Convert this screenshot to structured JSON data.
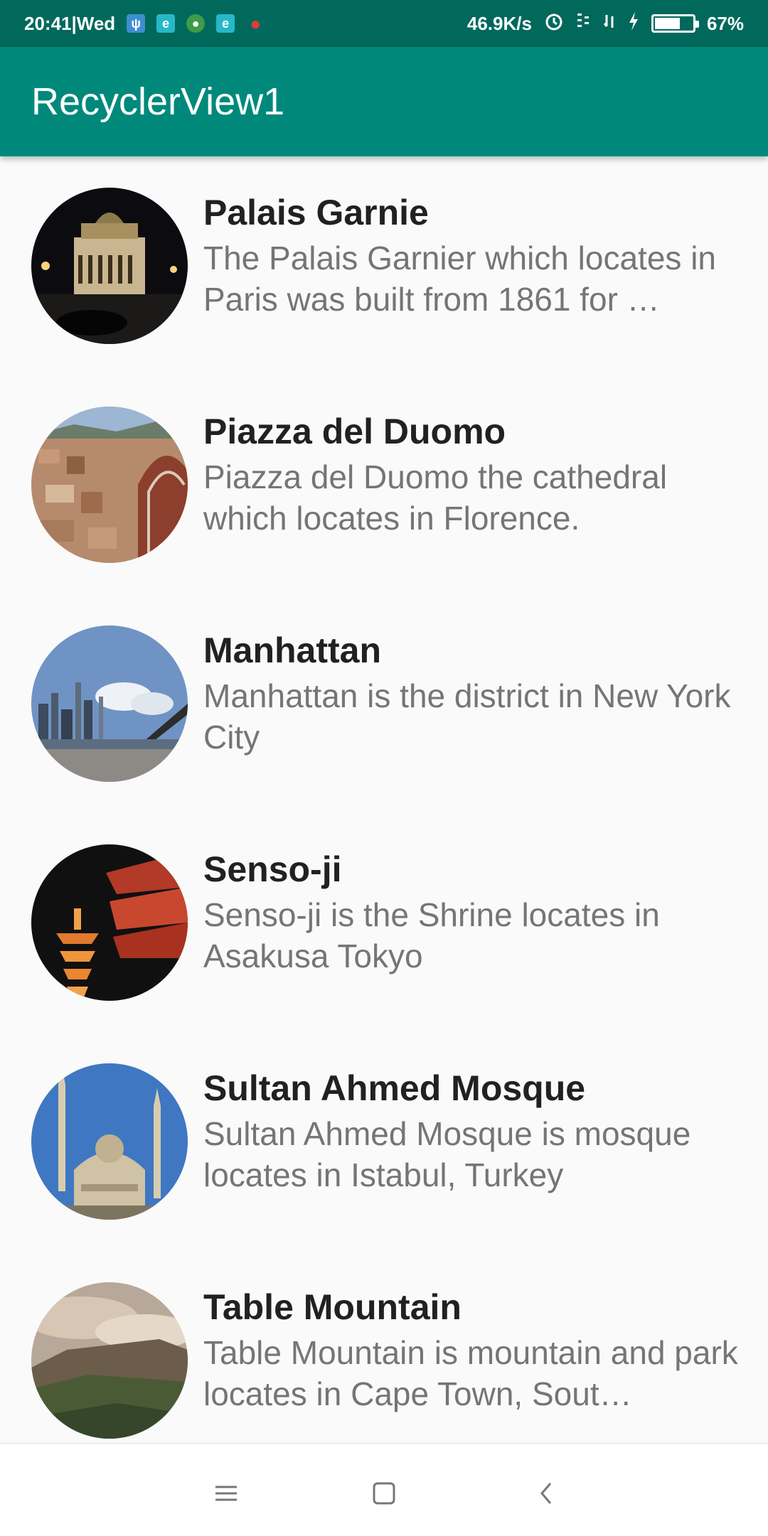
{
  "status_bar": {
    "time": "20:41|Wed",
    "network_speed": "46.9K/s",
    "battery_percent": "67%",
    "battery_level": 0.67
  },
  "app_bar": {
    "title": "RecyclerView1"
  },
  "items": [
    {
      "title": "Palais Garnie",
      "description": "The Palais Garnier which locates in Paris was built from 1861 for …"
    },
    {
      "title": "Piazza del Duomo",
      "description": "Piazza del Duomo the cathedral which locates in Florence."
    },
    {
      "title": "Manhattan",
      "description": "Manhattan is the district in New York City"
    },
    {
      "title": "Senso-ji",
      "description": "Senso-ji is the Shrine locates in Asakusa Tokyo"
    },
    {
      "title": "Sultan Ahmed Mosque",
      "description": "Sultan Ahmed Mosque is mosque locates in Istabul, Turkey"
    },
    {
      "title": "Table Mountain",
      "description": "Table Mountain is mountain and park locates in Cape Town, Sout…"
    }
  ],
  "colors": {
    "status_bar": "#00695c",
    "app_bar": "#00897b",
    "title_text": "#212121",
    "description_text": "#757575",
    "background": "#fafafa"
  },
  "nav_icons": [
    "menu-icon",
    "home-icon",
    "back-icon"
  ]
}
